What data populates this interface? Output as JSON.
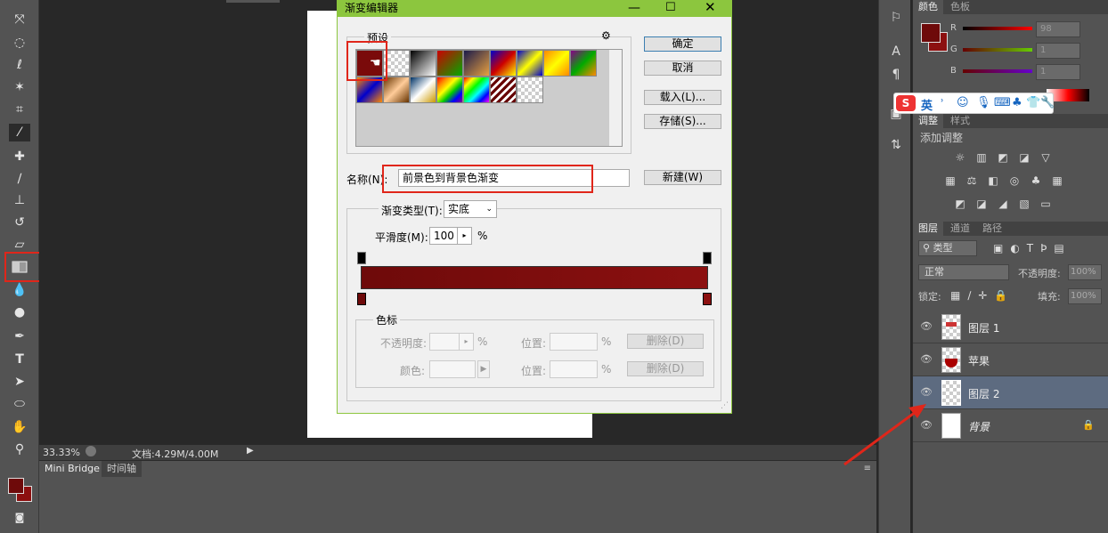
{
  "toolbar": {
    "fg_color": "#6e0a0a",
    "bg_color": "#8c1010"
  },
  "statusbar": {
    "zoom": "33.33%",
    "doc_info": "文档:4.29M/4.00M"
  },
  "bottom_tabs": [
    "Mini Bridge",
    "时间轴"
  ],
  "color_panel": {
    "tabs": [
      "颜色",
      "色板"
    ],
    "r_label": "R",
    "g_label": "G",
    "b_label": "B",
    "r_value": "98",
    "g_value": "1",
    "b_value": "1"
  },
  "ime": {
    "label": "英"
  },
  "adjust_panel": {
    "tabs": [
      "调整",
      "样式"
    ],
    "title": "添加调整"
  },
  "layers_panel": {
    "tabs": [
      "图层",
      "通道",
      "路径"
    ],
    "filter_label": "类型",
    "blend_mode": "正常",
    "opacity_label": "不透明度:",
    "opacity_value": "100%",
    "lock_label": "锁定:",
    "fill_label": "填充:",
    "fill_value": "100%",
    "layers": [
      {
        "name": "图层 1"
      },
      {
        "name": "苹果"
      },
      {
        "name": "图层 2"
      },
      {
        "name": "背景"
      }
    ]
  },
  "dialog": {
    "title": "渐变编辑器",
    "presets_label": "预设",
    "ok": "确定",
    "cancel": "取消",
    "load": "载入(L)...",
    "save": "存储(S)...",
    "name_label": "名称(N):",
    "name_value": "前景色到背景色渐变",
    "new_button": "新建(W)",
    "gradient_type_label": "渐变类型(T):",
    "gradient_type_value": "实底",
    "smoothness_label": "平滑度(M):",
    "smoothness_value": "100",
    "percent": "%",
    "stops_label": "色标",
    "opacity_label": "不透明度:",
    "color_label": "颜色:",
    "location_label": "位置:",
    "delete_label": "删除(D)",
    "gradient_start": "#6e0a0a",
    "gradient_end": "#8c1010"
  }
}
